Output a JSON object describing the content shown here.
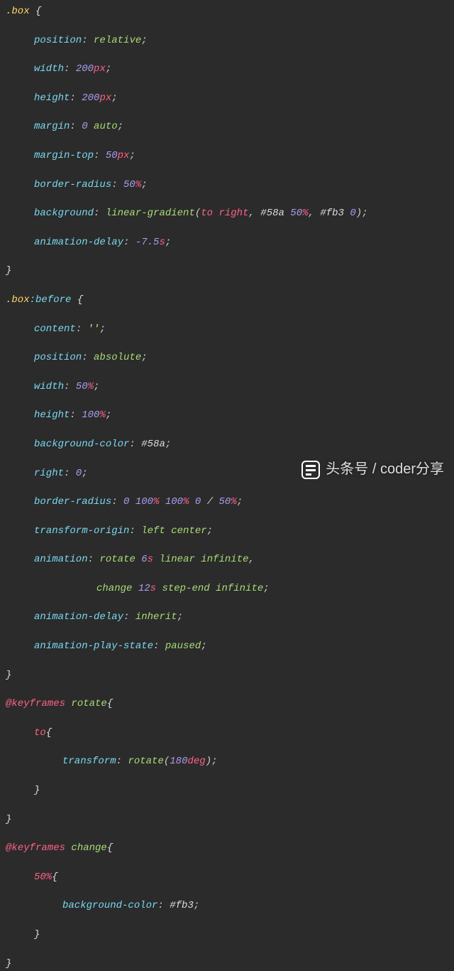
{
  "code": {
    "sel_box": ".box",
    "sel_box_before_a": ".box",
    "sel_box_before_b": ":before",
    "kw_keyframes": "@keyframes",
    "name_rotate": "rotate",
    "name_change": "change",
    "brace_open": " {",
    "brace_open2": "{",
    "brace_close": "}",
    "props": {
      "position": "position",
      "width": "width",
      "height": "height",
      "margin": "margin",
      "margin_top": "margin-top",
      "border_radius": "border-radius",
      "background": "background",
      "animation_delay": "animation-delay",
      "content": "content",
      "background_color": "background-color",
      "right": "right",
      "transform_origin": "transform-origin",
      "animation": "animation",
      "animation_play_state": "animation-play-state",
      "transform": "transform"
    },
    "vals": {
      "relative": "relative",
      "absolute": "absolute",
      "auto": "auto",
      "inherit": "inherit",
      "paused": "paused",
      "left_center": "left center",
      "linear_infinite": " linear infinite",
      "step_end_infinite": " step-end infinite",
      "to_kw": "to",
      "fifty_kw": "50%",
      "lingrad": "linear-gradient",
      "to_right": "to right",
      "rotate_fn": "rotate",
      "empty_str": "''",
      "col_58a": "#58a",
      "col_fb3": "#fb3"
    },
    "nums": {
      "n200": "200",
      "n0": "0",
      "n50": "50",
      "n100": "100",
      "neg75": "-7.5",
      "n6": "6",
      "n12": "12",
      "n180": "180"
    }
  },
  "watermark": {
    "text": "头条号 / coder分享"
  }
}
